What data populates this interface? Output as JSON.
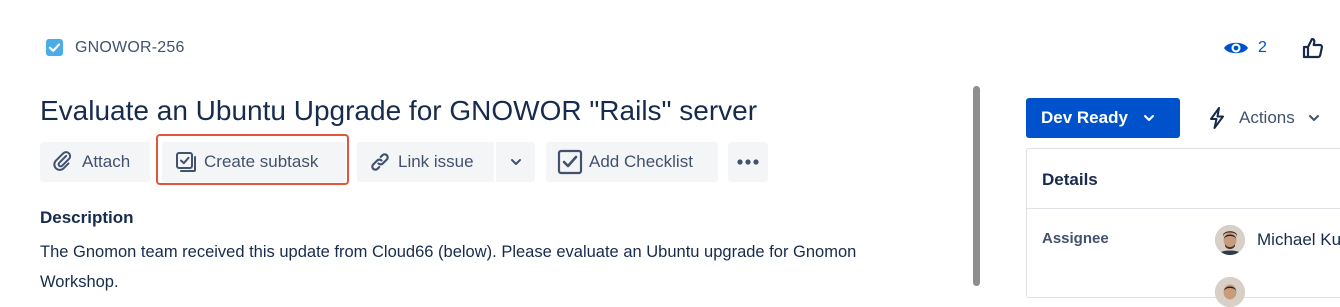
{
  "issue": {
    "key": "GNOWOR-256",
    "type_icon": "checkbox-task-icon",
    "title": "Evaluate an Ubuntu Upgrade for GNOWOR \"Rails\" server"
  },
  "header": {
    "watch_count": "2"
  },
  "toolbar": {
    "attach_label": "Attach",
    "create_subtask_label": "Create subtask",
    "link_issue_label": "Link issue",
    "add_checklist_label": "Add Checklist"
  },
  "description": {
    "heading": "Description",
    "body": "The Gnomon team received this update from Cloud66 (below). Please evaluate an Ubuntu upgrade for Gnomon Workshop."
  },
  "sidebar": {
    "status_label": "Dev Ready",
    "actions_label": "Actions",
    "details_title": "Details",
    "assignee_label": "Assignee",
    "assignee_name": "Michael Ku"
  },
  "colors": {
    "accent": "#0052cc",
    "highlight": "#e5533d",
    "task_icon": "#4bade8"
  }
}
